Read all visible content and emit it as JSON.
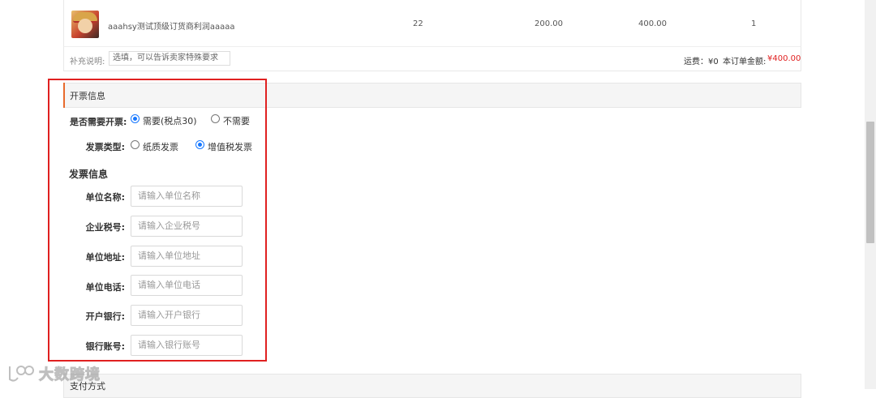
{
  "order_item": {
    "name": "aaahsy测试顶级订货商利润aaaaa",
    "qty": "22",
    "price": "200.00",
    "subtotal": "400.00",
    "extra": "1"
  },
  "note": {
    "label": "补充说明:",
    "placeholder": "选填，可以告诉卖家特殊要求"
  },
  "summary": {
    "shipping": "运费：¥0",
    "total_label": "本订单金额:",
    "total_value": "¥400.00"
  },
  "invoice": {
    "section_title": "开票信息",
    "need_invoice_label": "是否需要开票:",
    "need_options": [
      "需要(税点30)",
      "不需要"
    ],
    "need_selected": "需要(税点30)",
    "type_label": "发票类型:",
    "type_options": [
      "纸质发票",
      "增值税发票"
    ],
    "type_selected": "增值税发票",
    "info_title": "发票信息",
    "fields": [
      {
        "label": "单位名称:",
        "placeholder": "请输入单位名称"
      },
      {
        "label": "企业税号:",
        "placeholder": "请输入企业税号"
      },
      {
        "label": "单位地址:",
        "placeholder": "请输入单位地址"
      },
      {
        "label": "单位电话:",
        "placeholder": "请输入单位电话"
      },
      {
        "label": "开户银行:",
        "placeholder": "请输入开户银行"
      },
      {
        "label": "银行账号:",
        "placeholder": "请输入银行账号"
      }
    ]
  },
  "payment": {
    "section_title": "支付方式"
  },
  "watermark": {
    "text": "大数跨境"
  },
  "colors": {
    "accent": "#e86a2c",
    "radio_selected": "#1677ff",
    "price_red": "#e02020",
    "highlight_box": "#e02020"
  }
}
